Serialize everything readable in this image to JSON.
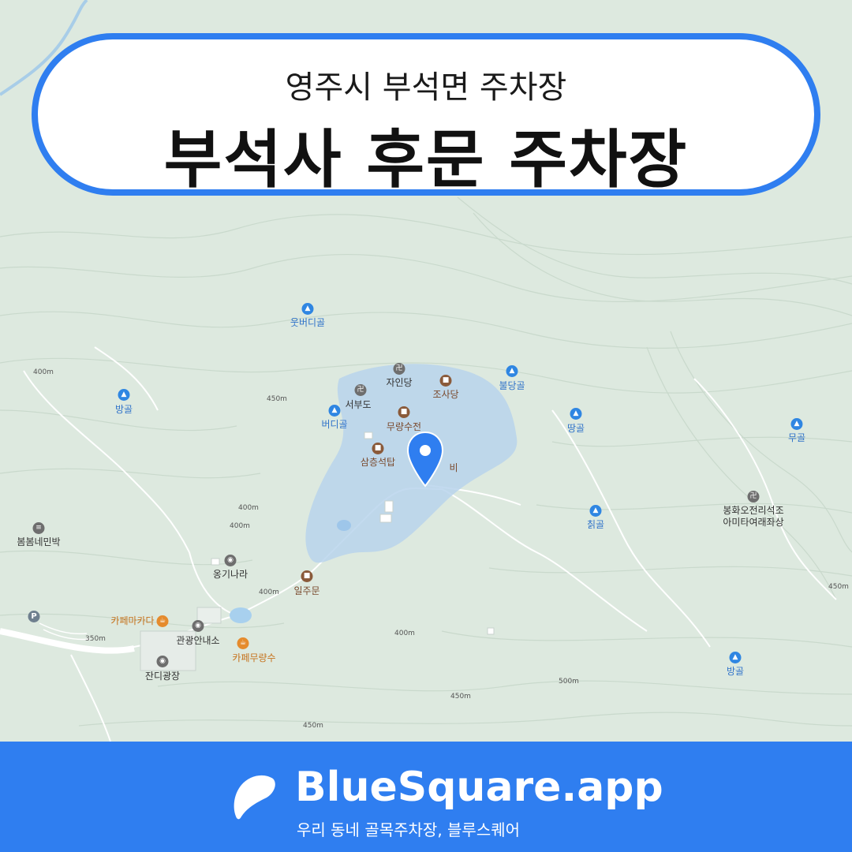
{
  "header": {
    "subtitle": "영주시 부석면 주차장",
    "title": "부석사 후문 주차장"
  },
  "footer": {
    "brand": "BlueSquare.app",
    "tagline": "우리 동네 골목주차장, 블루스퀘어"
  },
  "colors": {
    "accent": "#2f7ef0",
    "map_land": "#dde9df",
    "map_highlight": "#b9d3ec",
    "pin": "#2f7ef0"
  },
  "map": {
    "places": {
      "utbeodigol": "웃버디골",
      "bangol_west": "방골",
      "jaindang": "자인당",
      "josadang": "조사당",
      "buldanggol": "불당골",
      "seobudo": "서부도",
      "beodigol": "버디골",
      "muryangsujeon": "무량수전",
      "ttanggol": "땅골",
      "mugol": "무골",
      "samcheungseoktap": "삼층석탑",
      "bi": "비",
      "bonghwa_buddha": "봉화오전리석조\n아미타여래좌상",
      "chikgol": "칡골",
      "bombom_minbak": "봄봄네민박",
      "onggi_nara": "옹기나라",
      "iljumun": "일주문",
      "cafe_makada": "카페마카다",
      "tour_info": "관광안내소",
      "cafe_muryangsu": "카페무량수",
      "jandi_gwangjang": "잔디광장",
      "bangol_east": "방골",
      "parking": "P"
    },
    "elevations": {
      "e1": "400m",
      "e2": "450m",
      "e3": "400m",
      "e4": "400m",
      "e5": "400m",
      "e6": "350m",
      "e7": "400m",
      "e8": "450m",
      "e9": "500m",
      "e10": "450m",
      "e11": "450m"
    }
  }
}
